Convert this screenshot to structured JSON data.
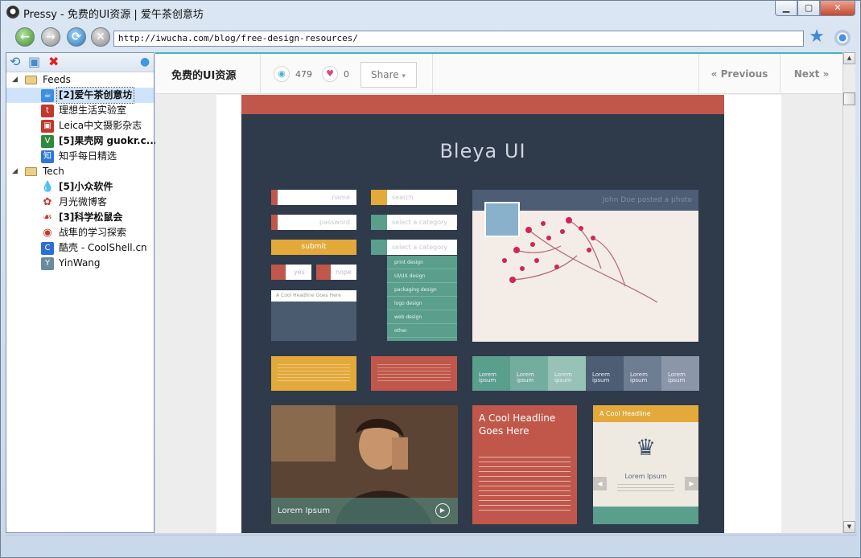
{
  "window": {
    "title": "Pressy - 免费的UI资源 | 爱午茶创意坊",
    "minimize": "▁",
    "maximize": "▢",
    "close": "✕"
  },
  "toolbar": {
    "url": "http://iwucha.com/blog/free-design-resources/",
    "back": "←",
    "forward": "→",
    "reload": "⟳",
    "stop": "✕",
    "add_star": "★"
  },
  "sidebar": {
    "tools": {
      "refresh": "⟲",
      "add_folder": "▣",
      "delete": "✖",
      "pin": "●"
    },
    "groups": [
      {
        "label": "Feeds",
        "expander": "◢",
        "feeds": [
          {
            "label": "[2]爱午茶创意坊",
            "bold": true,
            "selected": true,
            "icon": "tea-icon",
            "icon_char": "☕",
            "color": "#3d8ee0"
          },
          {
            "label": "理想生活实验室",
            "bold": false,
            "icon": "lab-icon",
            "icon_char": "t",
            "color": "#c0392b"
          },
          {
            "label": "Leica中文摄影杂志",
            "bold": false,
            "icon": "leica-icon",
            "icon_char": "▣",
            "color": "#c0392b"
          },
          {
            "label": "[5]果壳网 guokr.c...",
            "bold": true,
            "icon": "guokr-icon",
            "icon_char": "V",
            "color": "#2f8a3e"
          },
          {
            "label": "知乎每日精选",
            "bold": false,
            "icon": "zhihu-icon",
            "icon_char": "知",
            "color": "#2c78d4"
          }
        ]
      },
      {
        "label": "Tech",
        "expander": "◢",
        "feeds": [
          {
            "label": "[5]小众软件",
            "bold": true,
            "icon": "drop-icon",
            "icon_char": "💧",
            "color": "#ffffff"
          },
          {
            "label": "月光微博客",
            "bold": false,
            "icon": "moon-icon",
            "icon_char": "✿",
            "color": "#ffffff"
          },
          {
            "label": "[3]科学松鼠会",
            "bold": true,
            "icon": "squirrel-icon",
            "icon_char": "☙",
            "color": "#ffffff"
          },
          {
            "label": "战隼的学习探索",
            "bold": false,
            "icon": "globe-icon",
            "icon_char": "◉",
            "color": "#ffffff"
          },
          {
            "label": "酷壳 - CoolShell.cn",
            "bold": false,
            "icon": "coolshell-icon",
            "icon_char": "C",
            "color": "#2c6ed4"
          },
          {
            "label": "YinWang",
            "bold": false,
            "icon": "yinwang-icon",
            "icon_char": "Y",
            "color": "#6a8aa0"
          }
        ]
      }
    ]
  },
  "post": {
    "title": "免费的UI资源",
    "views": "479",
    "likes": "0",
    "view_icon": "◉",
    "like_icon": "♥",
    "share": "Share",
    "share_arrow": "▾",
    "prev": "« Previous",
    "next": "Next »"
  },
  "mockup": {
    "title": "Bleya UI",
    "fields": {
      "name": "name",
      "password": "password",
      "submit": "submit",
      "yes": "yes",
      "nope": "nope",
      "search": "search",
      "select1": "select a category",
      "select2": "select a category"
    },
    "headline_box": "A Cool Headline Goes Here",
    "menu": [
      "print design",
      "UI/UX design",
      "packaging design",
      "logo design",
      "web design",
      "other"
    ],
    "photo_caption": "John Doe posted a photo",
    "swatches": [
      "Lorem ipsum",
      "Lorem ipsum",
      "Lorem ipsum",
      "Lorem ipsum",
      "Lorem ipsum",
      "Lorem ipsum"
    ],
    "swatch_colors": [
      "#5a9e8c",
      "#73ad9d",
      "#97c2b5",
      "#4c5d74",
      "#6f7d92",
      "#8b97a8"
    ],
    "video_caption": "Lorem Ipsum",
    "red_headline": "A Cool Headline Goes Here",
    "card_headline": "A Cool Headline",
    "card_title": "Lorem Ipsum",
    "play": "▶",
    "crown": "♛"
  },
  "scroll": {
    "up": "▲",
    "down": "▼"
  }
}
